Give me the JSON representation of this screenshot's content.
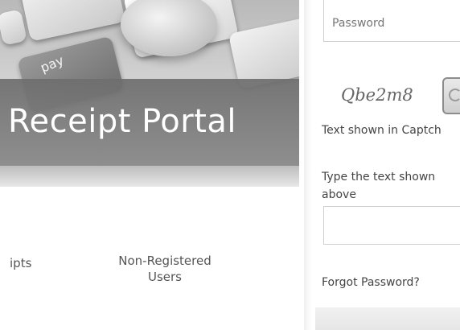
{
  "banner": {
    "title": "Receipt Portal",
    "key_label": "pay"
  },
  "tabs": {
    "receipts": "ipts",
    "non_registered": "Non-Registered Users"
  },
  "login": {
    "password_placeholder": "Password",
    "captcha_value": "Qbe2m8",
    "captcha_label": "Text shown in Captch",
    "type_label_line1": "Type the text shown",
    "type_label_line2": "above",
    "forgot_password": "Forgot Password?"
  },
  "icons": {
    "refresh": "refresh-icon"
  }
}
